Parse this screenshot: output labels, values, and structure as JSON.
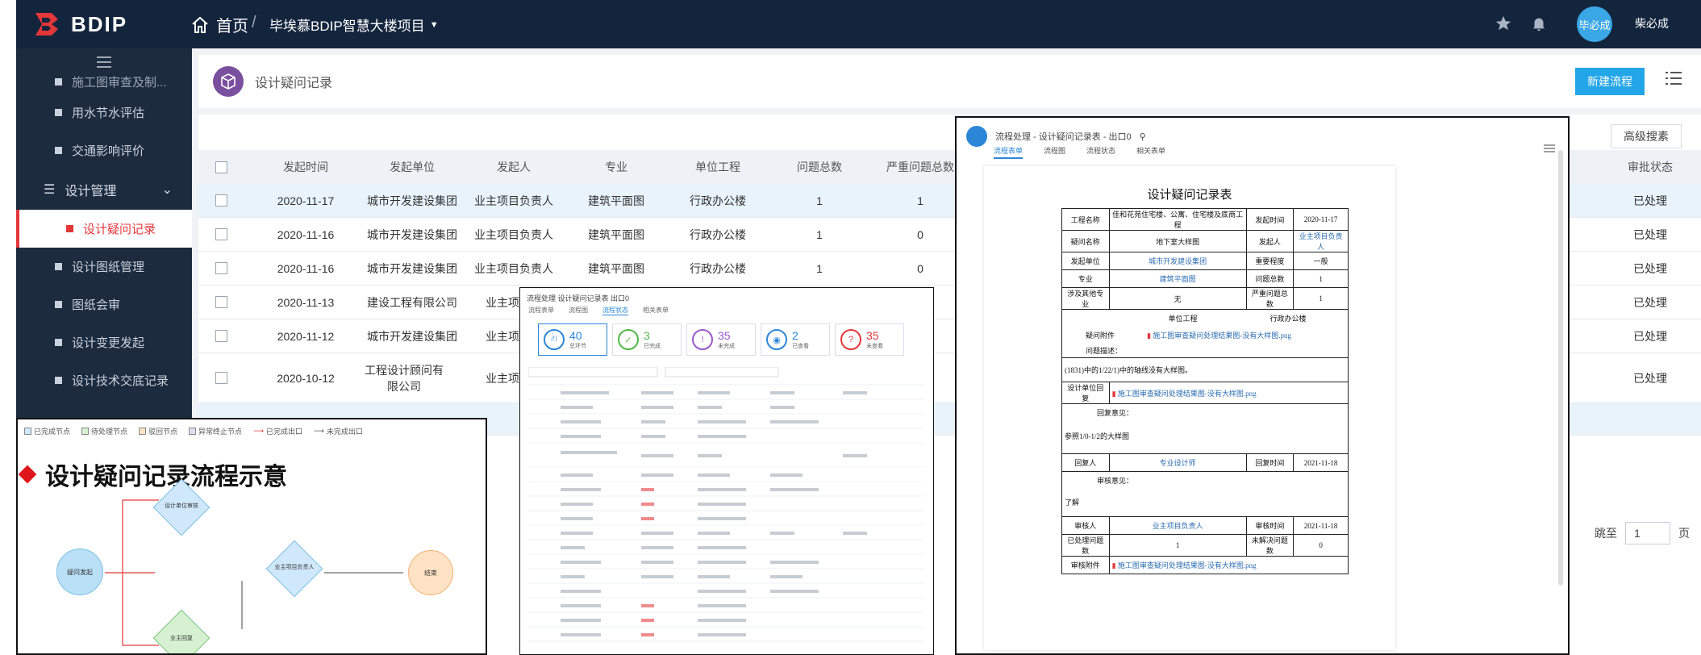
{
  "topbar": {
    "logo": "BDIP",
    "home": "首页",
    "sep": "/",
    "project": "毕埃慕BDIP智慧大楼项目",
    "avatar_text": "毕必成",
    "user": "柴必成"
  },
  "sidebar": {
    "partial_top": "施工图审查及制...",
    "items": [
      "用水节水评估",
      "交通影响评价"
    ],
    "group": "设计管理",
    "active": "设计疑问记录",
    "sub_items": [
      "设计图纸管理",
      "图纸会审",
      "设计变更发起",
      "设计技术交底记录"
    ]
  },
  "page": {
    "title": "设计疑问记录",
    "new_button": "新建流程",
    "advanced_search": "高级搜素"
  },
  "table": {
    "headers": [
      "发起时间",
      "发起单位",
      "发起人",
      "专业",
      "单位工程",
      "问题总数",
      "严重问题总数",
      "审批状态"
    ],
    "rows": [
      {
        "date": "2020-11-17",
        "unit": "城市开发建设集团",
        "person": "业主项目负责人",
        "major": "建筑平面图",
        "project": "行政办公楼",
        "total": "1",
        "serious": "1",
        "status": "已处理"
      },
      {
        "date": "2020-11-16",
        "unit": "城市开发建设集团",
        "person": "业主项目负责人",
        "major": "建筑平面图",
        "project": "行政办公楼",
        "total": "1",
        "serious": "0",
        "status": "已处理"
      },
      {
        "date": "2020-11-16",
        "unit": "城市开发建设集团",
        "person": "业主项目负责人",
        "major": "建筑平面图",
        "project": "行政办公楼",
        "total": "1",
        "serious": "0",
        "status": "已处理"
      },
      {
        "date": "2020-11-13",
        "unit": "建设工程有限公司",
        "person": "业主项目负",
        "major": "",
        "project": "",
        "total": "",
        "serious": "",
        "status": "已处理"
      },
      {
        "date": "2020-11-12",
        "unit": "城市开发建设集团",
        "person": "业主项目负",
        "major": "",
        "project": "",
        "total": "",
        "serious": "",
        "status": "已处理"
      },
      {
        "date": "2020-10-12",
        "unit": "工程设计顾问有限公司",
        "person": "业主项目负",
        "major": "",
        "project": "",
        "total": "",
        "serious": "",
        "status": "已处理"
      }
    ],
    "pager": {
      "goto": "跳至",
      "page_value": "1",
      "unit": "页"
    }
  },
  "flow_panel": {
    "legend": [
      "已完成节点",
      "待处理节点",
      "驳回节点",
      "异常终止节点",
      "已完成出口",
      "未完成出口"
    ],
    "title": "设计疑问记录流程示意",
    "nodes": [
      "疑问发起",
      "设计单位审核",
      "业主项目负责人",
      "业主回复",
      "结束"
    ]
  },
  "mini_panel": {
    "head": "流程处理 设计疑问记录表 出口0",
    "tabs": [
      "流程表单",
      "流程图",
      "流程状态",
      "相关表单"
    ],
    "stats": [
      {
        "num": "40",
        "label": "总环节",
        "icon": "⛙",
        "color": "#2b86d8"
      },
      {
        "num": "3",
        "label": "已完成",
        "icon": "✓",
        "color": "#52b84a"
      },
      {
        "num": "35",
        "label": "未完成",
        "icon": "!",
        "color": "#9b59c9"
      },
      {
        "num": "2",
        "label": "已查看",
        "icon": "◉",
        "color": "#2b86d8"
      },
      {
        "num": "35",
        "label": "未查看",
        "icon": "?",
        "color": "#e4373a"
      }
    ]
  },
  "form_panel": {
    "head": "流程处理 - 设计疑问记录表 - 出口0",
    "tabs": [
      "流程表单",
      "流程图",
      "流程状态",
      "相关表单"
    ],
    "doc_title": "设计疑问记录表",
    "rows": [
      [
        "工程名称",
        "佳和花苑住宅楼、公寓、住宅楼及底商工程",
        "发起时间",
        "2020-11-17"
      ],
      [
        "疑问名称",
        "地下室大样图",
        "发起人",
        "业主项目负责人"
      ],
      [
        "发起单位",
        "城市开发建设集团",
        "重要程度",
        "一般"
      ],
      [
        "专业",
        "建筑平面图",
        "问题总数",
        "1"
      ],
      [
        "涉及其他专业",
        "无",
        "严重问题总数",
        "1"
      ]
    ],
    "unit_project_label": "单位工程",
    "unit_project": "行政办公楼",
    "attach_label": "疑问附件",
    "attach_file": "施工图审查疑问处理结果图-没有大样图.png",
    "desc_label": "问题描述：",
    "desc": "(1831)中的1/22/1)中的轴线没有大样图。",
    "reply_attach_label": "设计单位回复",
    "reply_file": "施工图审查疑问处理结果图-没有大样图.png",
    "reply_label": "回复意见：",
    "reply": "参照1/0-1/2的大样图",
    "responder_label": "回复人",
    "responder": "专业设计师",
    "reply_time_label": "回复时间",
    "reply_time": "2021-11-18",
    "review_label": "审核意见：",
    "review": "了解",
    "reviewer_label": "审核人",
    "reviewer": "业主项目负责人",
    "review_time_label": "审核时间",
    "review_time": "2021-11-18",
    "solved_label": "已处理问题数",
    "solved": "1",
    "unsolved_label": "未解决问题数",
    "unsolved": "0",
    "approve_label": "审核附件",
    "approve_file": "施工图审查疑问处理结果图-没有大样图.png"
  }
}
